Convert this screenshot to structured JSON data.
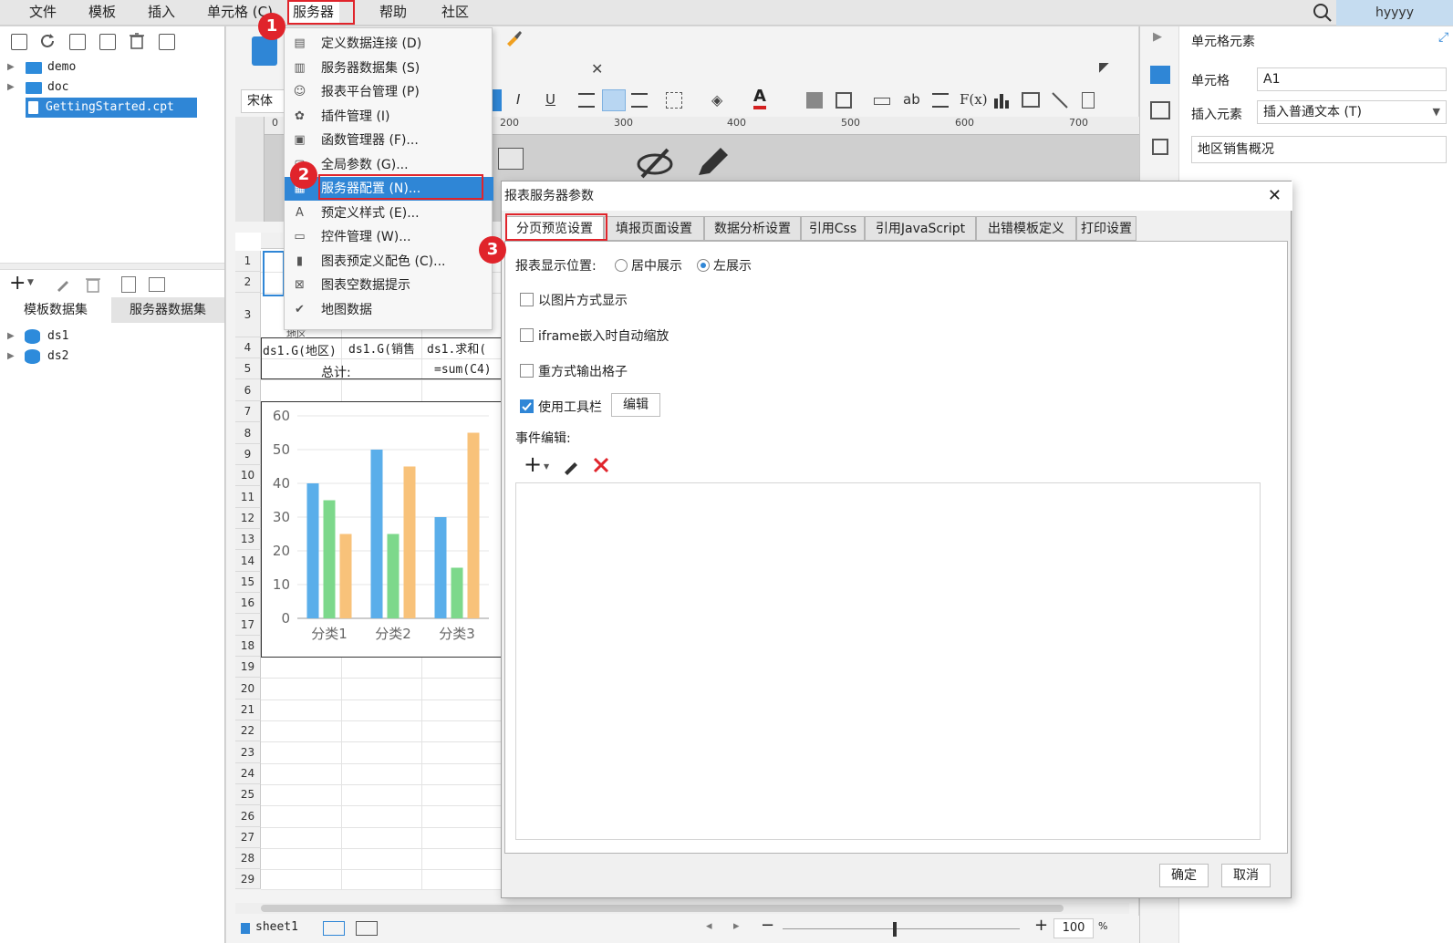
{
  "menubar": {
    "items": [
      "文件",
      "模板",
      "插入",
      "单元格 (C)",
      "服务器",
      "帮助",
      "社区"
    ],
    "user": "hyyyy"
  },
  "left_panel": {
    "tree": [
      {
        "label": "demo",
        "type": "folder"
      },
      {
        "label": "doc",
        "type": "folder"
      },
      {
        "label": "GettingStarted.cpt",
        "type": "file"
      }
    ],
    "dataset_tabs": [
      "模板数据集",
      "服务器数据集"
    ],
    "datasets": [
      "ds1",
      "ds2"
    ]
  },
  "toolbar": {
    "font": "宋体",
    "buttons": [
      "I",
      "U",
      "ab",
      "F(x)"
    ]
  },
  "ruler": [
    "0",
    "200",
    "300",
    "400",
    "500",
    "600",
    "700"
  ],
  "sheet": {
    "rows": [
      "1",
      "2",
      "3",
      "4",
      "5",
      "6",
      "7",
      "8",
      "9",
      "10",
      "11",
      "12",
      "13",
      "14",
      "15",
      "16",
      "17",
      "18",
      "19",
      "20",
      "21",
      "22",
      "23",
      "24",
      "25",
      "26",
      "27",
      "28",
      "29"
    ],
    "cells": {
      "r3_label": "地区",
      "r4_a": "ds1.G(地区)",
      "r4_b": "ds1.G(销售",
      "r4_c": "ds1.求和(",
      "r5_b": "总计:",
      "r5_c": "=sum(C4)"
    }
  },
  "chart_data": {
    "type": "bar",
    "categories": [
      "分类1",
      "分类2",
      "分类3"
    ],
    "series": [
      {
        "values": [
          40,
          50,
          30
        ],
        "color": "#5aaeea"
      },
      {
        "values": [
          35,
          25,
          15
        ],
        "color": "#7dd88b"
      },
      {
        "values": [
          25,
          45,
          55
        ],
        "color": "#f8c27a"
      }
    ],
    "ylim": [
      0,
      60
    ],
    "yticks": [
      "0",
      "10",
      "20",
      "30",
      "40",
      "50",
      "60"
    ],
    "grid": true
  },
  "server_menu": {
    "items": [
      {
        "label": "定义数据连接 (D)",
        "icon": "db-connect-icon"
      },
      {
        "label": "服务器数据集 (S)",
        "icon": "server-dataset-icon"
      },
      {
        "label": "报表平台管理 (P)",
        "icon": "user-icon"
      },
      {
        "label": "插件管理 (I)",
        "icon": "puzzle-icon"
      },
      {
        "label": "函数管理器 (F)...",
        "icon": "function-icon"
      },
      {
        "label": "全局参数 (G)...",
        "icon": "global-param-icon"
      },
      {
        "label": "服务器配置 (N)...",
        "icon": "server-config-icon"
      },
      {
        "label": "预定义样式 (E)...",
        "icon": "style-icon"
      },
      {
        "label": "控件管理 (W)...",
        "icon": "widget-icon"
      },
      {
        "label": "图表预定义配色 (C)...",
        "icon": "chart-color-icon"
      },
      {
        "label": "图表空数据提示",
        "icon": "empty-data-icon"
      },
      {
        "label": "地图数据",
        "icon": "map-icon"
      }
    ]
  },
  "badges": [
    "1",
    "2",
    "3"
  ],
  "right_panel": {
    "title": "单元格元素",
    "cell_label": "单元格",
    "cell_value": "A1",
    "insert_label": "插入元素",
    "insert_value": "插入普通文本 (T)",
    "content": "地区销售概况"
  },
  "dialog": {
    "title": "报表服务器参数",
    "tabs": [
      "分页预览设置",
      "填报页面设置",
      "数据分析设置",
      "引用Css",
      "引用JavaScript",
      "出错模板定义",
      "打印设置"
    ],
    "position_label": "报表显示位置:",
    "position_options": [
      "居中展示",
      "左展示"
    ],
    "position_selected": "左展示",
    "checkboxes": [
      {
        "label": "以图片方式显示",
        "checked": false
      },
      {
        "label": "iframe嵌入时自动缩放",
        "checked": false
      },
      {
        "label": "重方式输出格子",
        "checked": false
      },
      {
        "label": "使用工具栏",
        "checked": true
      }
    ],
    "edit_button": "编辑",
    "event_label": "事件编辑:",
    "ok": "确定",
    "cancel": "取消"
  },
  "status": {
    "sheet": "sheet1",
    "zoom": "100",
    "zoom_unit": "%"
  },
  "colors": {
    "accent": "#2f86d6",
    "highlight": "#e0242b"
  }
}
